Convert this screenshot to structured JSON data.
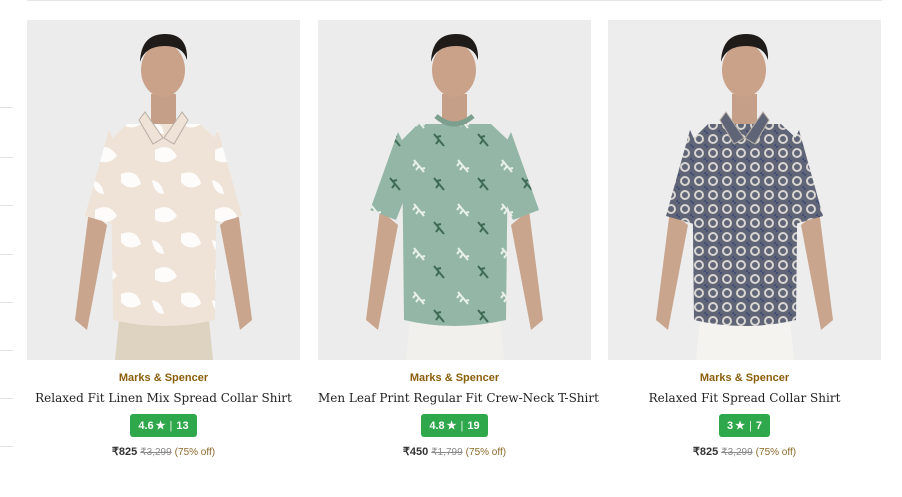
{
  "products": [
    {
      "brand": "Marks & Spencer",
      "name": "Relaxed Fit Linen Mix Spread Collar Shirt",
      "rating": "4.6",
      "reviews": "13",
      "price": "₹825",
      "mrp": "₹3,299",
      "discount": "(75% off)",
      "shirt_color": "#efe2d6",
      "pattern_color": "#ffffff",
      "trouser_color": "#ded3c1",
      "bg_color": "#ececec"
    },
    {
      "brand": "Marks & Spencer",
      "name": "Men Leaf Print Regular Fit Crew-Neck T-Shirt",
      "rating": "4.8",
      "reviews": "19",
      "price": "₹450",
      "mrp": "₹1,799",
      "discount": "(75% off)",
      "shirt_color": "#94b6a6",
      "pattern_color": "#e8f0ea",
      "trouser_color": "#f1f0ec",
      "bg_color": "#ececec"
    },
    {
      "brand": "Marks & Spencer",
      "name": "Relaxed Fit Spread Collar Shirt",
      "rating": "3",
      "reviews": "7",
      "price": "₹825",
      "mrp": "₹3,299",
      "discount": "(75% off)",
      "shirt_color": "#5f6577",
      "pattern_color": "#d9d6d2",
      "trouser_color": "#f4f3ef",
      "bg_color": "#ededed"
    }
  ],
  "rating_star": "★",
  "rating_separator": "|",
  "rating_badge_color": "#2ea84a",
  "brand_color": "#8b5e0b"
}
